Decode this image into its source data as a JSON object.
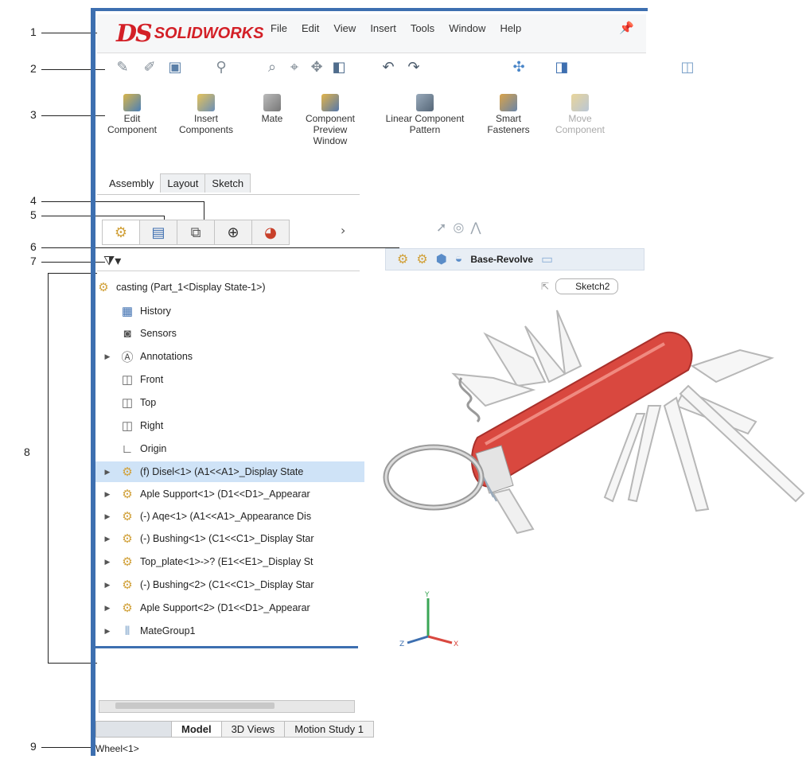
{
  "callouts": [
    "1",
    "2",
    "3",
    "4",
    "5",
    "6",
    "7",
    "8",
    "9"
  ],
  "app": {
    "logo_mark": "DS",
    "logo_text": "SOLIDWORKS"
  },
  "menu": [
    "File",
    "Edit",
    "View",
    "Insert",
    "Tools",
    "Window",
    "Help"
  ],
  "command_manager": {
    "commands": [
      {
        "label": "Edit Component",
        "icon": "edit-component-icon"
      },
      {
        "label": "Insert Components",
        "icon": "insert-components-icon"
      },
      {
        "label": "Mate",
        "icon": "mate-icon"
      },
      {
        "label": "Component Preview Window",
        "icon": "preview-window-icon"
      },
      {
        "label": "Linear Component Pattern",
        "icon": "linear-pattern-icon"
      },
      {
        "label": "Smart Fasteners",
        "icon": "smart-fasteners-icon"
      },
      {
        "label": "Move Component",
        "icon": "move-component-icon"
      }
    ],
    "tabs": [
      "Assembly",
      "Layout",
      "Sketch"
    ],
    "active_tab": "Assembly"
  },
  "breadcrumb": {
    "item": "Base-Revolve",
    "sketch": "Sketch2"
  },
  "tree": {
    "root": "casting (Part_1<Display State-1>)",
    "items": [
      {
        "label": "History",
        "icon": "history-icon",
        "expand": false
      },
      {
        "label": "Sensors",
        "icon": "sensors-icon",
        "expand": false
      },
      {
        "label": "Annotations",
        "icon": "annotations-icon",
        "expand": true
      },
      {
        "label": "Front",
        "icon": "plane-icon",
        "expand": false
      },
      {
        "label": "Top",
        "icon": "plane-icon",
        "expand": false
      },
      {
        "label": "Right",
        "icon": "plane-icon",
        "expand": false
      },
      {
        "label": "Origin",
        "icon": "origin-icon",
        "expand": false
      },
      {
        "label": "(f) Disel<1> (A1<<A1>_Display State",
        "icon": "part-icon",
        "expand": true,
        "selected": true
      },
      {
        "label": "Aple Support<1> (D1<<D1>_Appearar",
        "icon": "part-icon",
        "expand": true
      },
      {
        "label": "(-) Aqe<1> (A1<<A1>_Appearance Dis",
        "icon": "part-icon",
        "expand": true
      },
      {
        "label": "(-) Bushing<1> (C1<<C1>_Display Star",
        "icon": "part-icon",
        "expand": true
      },
      {
        "label": "Top_plate<1>->? (E1<<E1>_Display St",
        "icon": "part-icon",
        "expand": true
      },
      {
        "label": "(-) Bushing<2> (C1<<C1>_Display Star",
        "icon": "part-icon",
        "expand": true
      },
      {
        "label": "Aple Support<2> (D1<<D1>_Appearar",
        "icon": "part-icon",
        "expand": true
      },
      {
        "label": "MateGroup1",
        "icon": "mategroup-icon",
        "expand": true
      }
    ]
  },
  "bottom_tabs": [
    "Model",
    "3D Views",
    "Motion Study 1"
  ],
  "status": "Wheel<1>",
  "colors": {
    "brand_red": "#d32027",
    "frame_blue": "#3d6fb0",
    "selected_row": "#cfe3f7",
    "knife_red": "#d9483f"
  },
  "triad": {
    "x": "X",
    "y": "Y",
    "z": "Z"
  }
}
